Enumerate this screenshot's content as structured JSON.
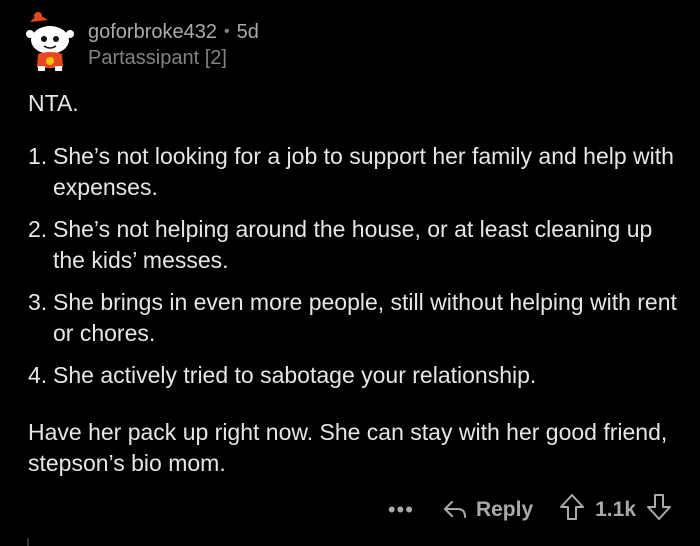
{
  "comment": {
    "author": "goforbroke432",
    "separator": "•",
    "age": "5d",
    "flair": "Partassipant [2]",
    "verdict": "NTA.",
    "points": [
      {
        "number": "1.",
        "text": "She’s not looking for a job to support her family and help with expenses."
      },
      {
        "number": "2.",
        "text": "She’s not helping around the house, or at least cleaning up the kids’ messes."
      },
      {
        "number": "3.",
        "text": "She brings in even more people, still without helping with rent or chores."
      },
      {
        "number": "4.",
        "text": "She actively tried to sabotage your relationship."
      }
    ],
    "closing": "Have her pack up right now. She can stay with her good friend, stepson’s bio mom."
  },
  "actions": {
    "more_label": "•••",
    "reply_label": "Reply",
    "score": "1.1k"
  },
  "icons": {
    "avatar": "snoo-avatar-icon",
    "reply": "reply-arrow-icon",
    "upvote": "upvote-arrow-icon",
    "downvote": "downvote-arrow-icon"
  },
  "colors": {
    "background": "#000000",
    "text": "#e4e6e7",
    "muted": "#818384",
    "avatar_accent": "#e8471f"
  }
}
